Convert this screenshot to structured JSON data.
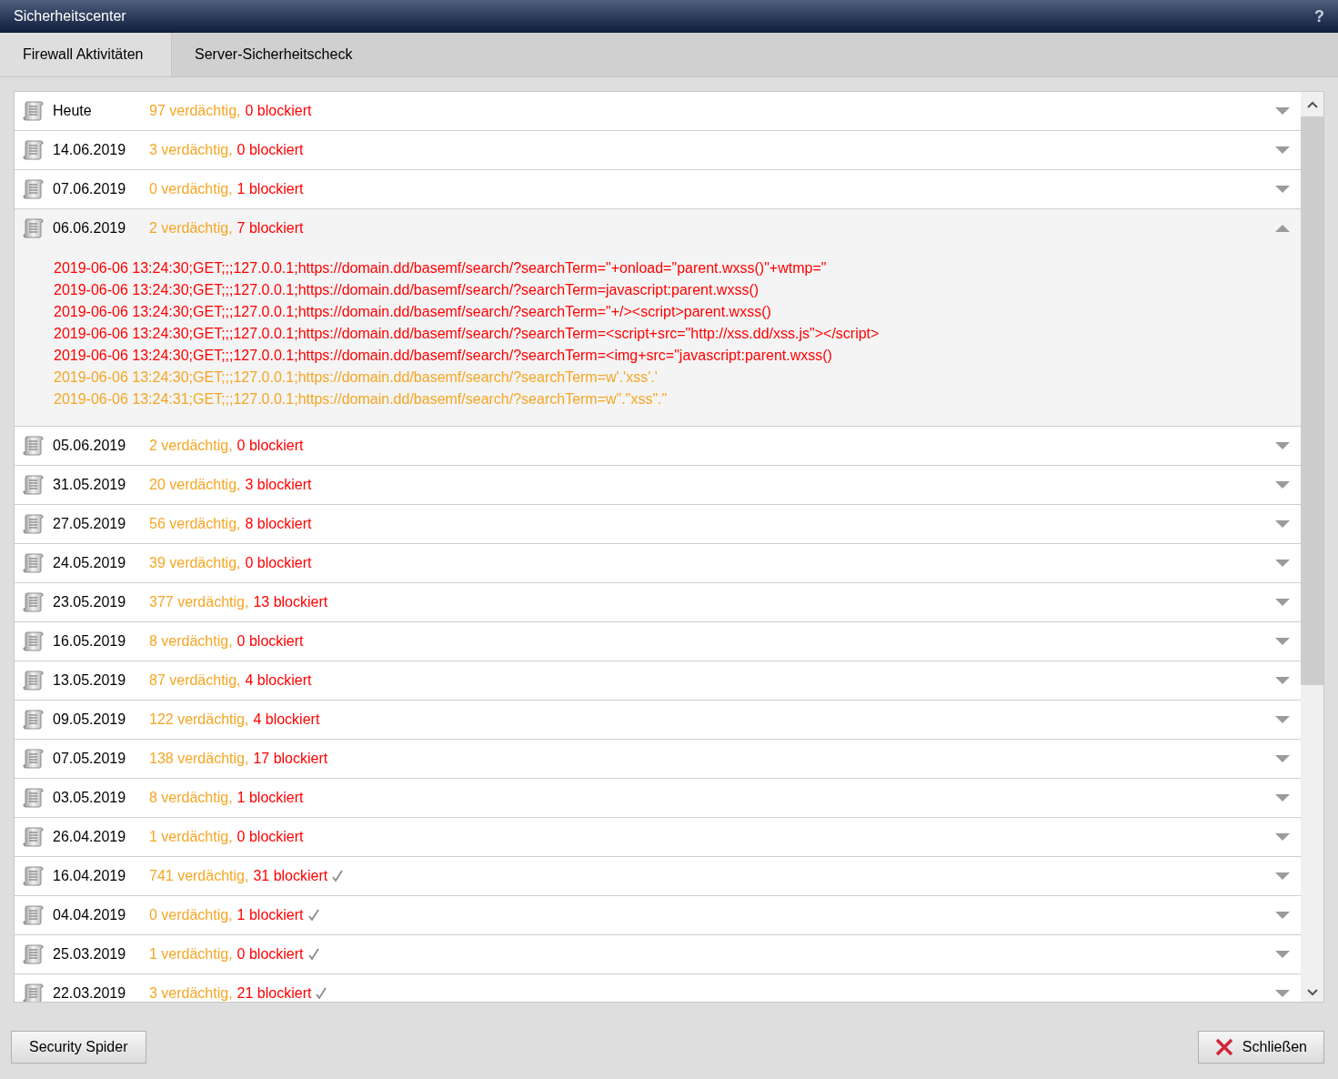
{
  "window": {
    "title": "Sicherheitscenter",
    "help": "?"
  },
  "tabs": [
    {
      "label": "Firewall Aktivitäten",
      "selected": true
    },
    {
      "label": "Server-Sicherheitscheck",
      "selected": false
    }
  ],
  "days": [
    {
      "date": "Heute",
      "suspicious": "97 verdächtig,",
      "blocked": "0 blockiert",
      "confirmed": false,
      "expanded": false
    },
    {
      "date": "14.06.2019",
      "suspicious": "3 verdächtig,",
      "blocked": "0 blockiert",
      "confirmed": false,
      "expanded": false
    },
    {
      "date": "07.06.2019",
      "suspicious": "0 verdächtig,",
      "blocked": "1 blockiert",
      "confirmed": false,
      "expanded": false
    },
    {
      "date": "06.06.2019",
      "suspicious": "2 verdächtig,",
      "blocked": "7 blockiert",
      "confirmed": false,
      "expanded": true,
      "entries": [
        {
          "kind": "blocked",
          "text": "2019-06-06 13:24:30;GET;;;127.0.0.1;https://domain.dd/basemf/search/?searchTerm=\"+onload=\"parent.wxss()\"+wtmp=\""
        },
        {
          "kind": "blocked",
          "text": "2019-06-06 13:24:30;GET;;;127.0.0.1;https://domain.dd/basemf/search/?searchTerm=javascript:parent.wxss()"
        },
        {
          "kind": "blocked",
          "text": "2019-06-06 13:24:30;GET;;;127.0.0.1;https://domain.dd/basemf/search/?searchTerm=\"+/><script>parent.wxss()"
        },
        {
          "kind": "blocked",
          "text": "2019-06-06 13:24:30;GET;;;127.0.0.1;https://domain.dd/basemf/search/?searchTerm=<script+src=\"http://xss.dd/xss.js\"></script>"
        },
        {
          "kind": "blocked",
          "text": "2019-06-06 13:24:30;GET;;;127.0.0.1;https://domain.dd/basemf/search/?searchTerm=<img+src=\"javascript:parent.wxss()"
        },
        {
          "kind": "suspicious",
          "text": "2019-06-06 13:24:30;GET;;;127.0.0.1;https://domain.dd/basemf/search/?searchTerm=w'.'xss'.'"
        },
        {
          "kind": "suspicious",
          "text": "2019-06-06 13:24:31;GET;;;127.0.0.1;https://domain.dd/basemf/search/?searchTerm=w\".\"xss\".\""
        }
      ]
    },
    {
      "date": "05.06.2019",
      "suspicious": "2 verdächtig,",
      "blocked": "0 blockiert",
      "confirmed": false,
      "expanded": false
    },
    {
      "date": "31.05.2019",
      "suspicious": "20 verdächtig,",
      "blocked": "3 blockiert",
      "confirmed": false,
      "expanded": false
    },
    {
      "date": "27.05.2019",
      "suspicious": "56 verdächtig,",
      "blocked": "8 blockiert",
      "confirmed": false,
      "expanded": false
    },
    {
      "date": "24.05.2019",
      "suspicious": "39 verdächtig,",
      "blocked": "0 blockiert",
      "confirmed": false,
      "expanded": false
    },
    {
      "date": "23.05.2019",
      "suspicious": "377 verdächtig,",
      "blocked": "13 blockiert",
      "confirmed": false,
      "expanded": false
    },
    {
      "date": "16.05.2019",
      "suspicious": "8 verdächtig,",
      "blocked": "0 blockiert",
      "confirmed": false,
      "expanded": false
    },
    {
      "date": "13.05.2019",
      "suspicious": "87 verdächtig,",
      "blocked": "4 blockiert",
      "confirmed": false,
      "expanded": false
    },
    {
      "date": "09.05.2019",
      "suspicious": "122 verdächtig,",
      "blocked": "4 blockiert",
      "confirmed": false,
      "expanded": false
    },
    {
      "date": "07.05.2019",
      "suspicious": "138 verdächtig,",
      "blocked": "17 blockiert",
      "confirmed": false,
      "expanded": false
    },
    {
      "date": "03.05.2019",
      "suspicious": "8 verdächtig,",
      "blocked": "1 blockiert",
      "confirmed": false,
      "expanded": false
    },
    {
      "date": "26.04.2019",
      "suspicious": "1 verdächtig,",
      "blocked": "0 blockiert",
      "confirmed": false,
      "expanded": false
    },
    {
      "date": "16.04.2019",
      "suspicious": "741 verdächtig,",
      "blocked": "31 blockiert",
      "confirmed": true,
      "expanded": false
    },
    {
      "date": "04.04.2019",
      "suspicious": "0 verdächtig,",
      "blocked": "1 blockiert",
      "confirmed": true,
      "expanded": false
    },
    {
      "date": "25.03.2019",
      "suspicious": "1 verdächtig,",
      "blocked": "0 blockiert",
      "confirmed": true,
      "expanded": false
    },
    {
      "date": "22.03.2019",
      "suspicious": "3 verdächtig,",
      "blocked": "21 blockiert",
      "confirmed": true,
      "expanded": false
    }
  ],
  "buttons": {
    "left": "Security Spider",
    "close": "Schließen"
  }
}
